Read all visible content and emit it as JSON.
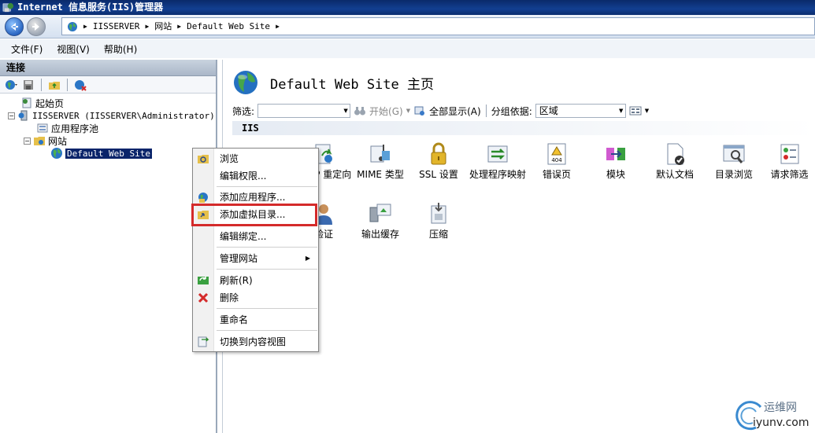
{
  "window": {
    "title": "Internet 信息服务(IIS)管理器"
  },
  "address_bar": {
    "crumbs": [
      "IISSERVER",
      "网站",
      "Default Web Site"
    ]
  },
  "menu": {
    "file": "文件(F)",
    "view": "视图(V)",
    "help": "帮助(H)"
  },
  "connections": {
    "header": "连接",
    "tree": {
      "start_page": "起始页",
      "server": "IISSERVER (IISSERVER\\Administrator)",
      "app_pools": "应用程序池",
      "sites": "网站",
      "default_site": "Default Web Site"
    }
  },
  "main": {
    "page_title": "Default Web Site 主页",
    "filter": {
      "label": "筛选:",
      "start_label": "开始(G)",
      "show_all_label": "全部显示(A)",
      "group_by_label": "分组依据:",
      "group_by_value": "区域"
    },
    "group_header": "IIS",
    "features_row1": [
      {
        "label": "HTTP 重定向",
        "icon": "redirect-icon"
      },
      {
        "label": "MIME 类型",
        "icon": "mime-icon"
      },
      {
        "label": "SSL 设置",
        "icon": "lock-icon"
      },
      {
        "label": "处理程序映射",
        "icon": "handler-mapping-icon"
      },
      {
        "label": "错误页",
        "icon": "error-page-icon"
      },
      {
        "label": "模块",
        "icon": "modules-icon"
      },
      {
        "label": "默认文档",
        "icon": "default-document-icon"
      },
      {
        "label": "目录浏览",
        "icon": "directory-browsing-icon"
      },
      {
        "label": "请求筛选",
        "icon": "request-filtering-icon"
      }
    ],
    "features_row2": [
      {
        "label": "验证",
        "icon": "authentication-icon"
      },
      {
        "label": "输出缓存",
        "icon": "output-cache-icon"
      },
      {
        "label": "压缩",
        "icon": "compression-icon"
      }
    ],
    "error_icon_text": "404"
  },
  "context_menu": {
    "items": [
      {
        "label": "浏览",
        "icon": "explore-icon"
      },
      {
        "label": "编辑权限...",
        "icon": ""
      },
      {
        "label": "添加应用程序...",
        "icon": "add-application-icon"
      },
      {
        "label": "添加虚拟目录...",
        "icon": "add-virtual-directory-icon"
      },
      {
        "label": "编辑绑定...",
        "icon": ""
      },
      {
        "label": "管理网站",
        "icon": ""
      },
      {
        "label": "刷新(R)",
        "icon": "refresh-icon"
      },
      {
        "label": "删除",
        "icon": "delete-icon"
      },
      {
        "label": "重命名",
        "icon": ""
      },
      {
        "label": "切换到内容视图",
        "icon": "content-view-icon"
      }
    ]
  },
  "watermark": {
    "line1": "运维网",
    "line2": "iyunv.com"
  },
  "colors": {
    "title_bar": "#123f91",
    "selection": "#0a246a",
    "highlight_border": "#d42a2a"
  }
}
